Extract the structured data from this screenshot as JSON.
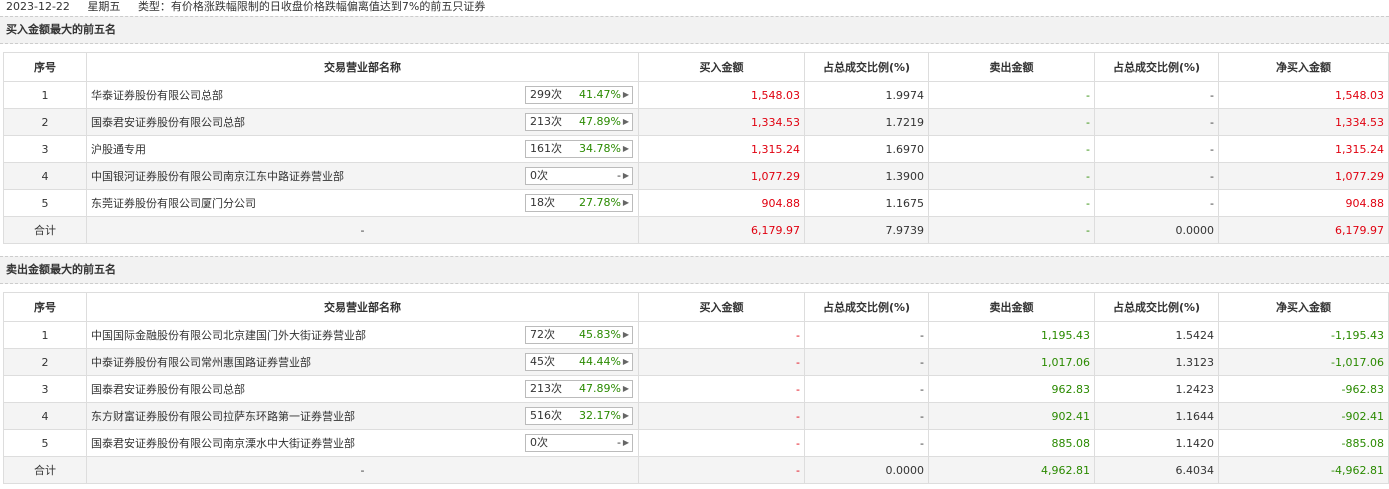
{
  "header": {
    "date": "2023-12-22",
    "weekday": "星期五",
    "type_label": "类型：有价格涨跌幅限制的日收盘价格跌幅偏离值达到7%的前五只证券"
  },
  "columns": [
    "序号",
    "交易营业部名称",
    "买入金额",
    "占总成交比例(%)",
    "卖出金额",
    "占总成交比例(%)",
    "净买入金额"
  ],
  "buy_section": {
    "title": "买入金额最大的前五名",
    "rows": [
      {
        "idx": "1",
        "name": "华泰证券股份有限公司总部",
        "count": "299次",
        "pct": "41.47%",
        "buy": "1,548.03",
        "buy_ratio": "1.9974",
        "sell": "-",
        "sell_ratio": "-",
        "net": "1,548.03"
      },
      {
        "idx": "2",
        "name": "国泰君安证券股份有限公司总部",
        "count": "213次",
        "pct": "47.89%",
        "buy": "1,334.53",
        "buy_ratio": "1.7219",
        "sell": "-",
        "sell_ratio": "-",
        "net": "1,334.53"
      },
      {
        "idx": "3",
        "name": "沪股通专用",
        "count": "161次",
        "pct": "34.78%",
        "buy": "1,315.24",
        "buy_ratio": "1.6970",
        "sell": "-",
        "sell_ratio": "-",
        "net": "1,315.24"
      },
      {
        "idx": "4",
        "name": "中国银河证券股份有限公司南京江东中路证券营业部",
        "count": "0次",
        "pct": "-",
        "buy": "1,077.29",
        "buy_ratio": "1.3900",
        "sell": "-",
        "sell_ratio": "-",
        "net": "1,077.29"
      },
      {
        "idx": "5",
        "name": "东莞证券股份有限公司厦门分公司",
        "count": "18次",
        "pct": "27.78%",
        "buy": "904.88",
        "buy_ratio": "1.1675",
        "sell": "-",
        "sell_ratio": "-",
        "net": "904.88"
      }
    ],
    "total": {
      "label": "合计",
      "name": "-",
      "buy": "6,179.97",
      "buy_ratio": "7.9739",
      "sell": "-",
      "sell_ratio": "0.0000",
      "net": "6,179.97"
    }
  },
  "sell_section": {
    "title": "卖出金额最大的前五名",
    "rows": [
      {
        "idx": "1",
        "name": "中国国际金融股份有限公司北京建国门外大街证券营业部",
        "count": "72次",
        "pct": "45.83%",
        "buy": "-",
        "buy_ratio": "-",
        "sell": "1,195.43",
        "sell_ratio": "1.5424",
        "net": "-1,195.43"
      },
      {
        "idx": "2",
        "name": "中泰证券股份有限公司常州惠国路证券营业部",
        "count": "45次",
        "pct": "44.44%",
        "buy": "-",
        "buy_ratio": "-",
        "sell": "1,017.06",
        "sell_ratio": "1.3123",
        "net": "-1,017.06"
      },
      {
        "idx": "3",
        "name": "国泰君安证券股份有限公司总部",
        "count": "213次",
        "pct": "47.89%",
        "buy": "-",
        "buy_ratio": "-",
        "sell": "962.83",
        "sell_ratio": "1.2423",
        "net": "-962.83"
      },
      {
        "idx": "4",
        "name": "东方财富证券股份有限公司拉萨东环路第一证券营业部",
        "count": "516次",
        "pct": "32.17%",
        "buy": "-",
        "buy_ratio": "-",
        "sell": "902.41",
        "sell_ratio": "1.1644",
        "net": "-902.41"
      },
      {
        "idx": "5",
        "name": "国泰君安证券股份有限公司南京溧水中大街证券营业部",
        "count": "0次",
        "pct": "-",
        "buy": "-",
        "buy_ratio": "-",
        "sell": "885.08",
        "sell_ratio": "1.1420",
        "net": "-885.08"
      }
    ],
    "total": {
      "label": "合计",
      "name": "-",
      "buy": "-",
      "buy_ratio": "0.0000",
      "sell": "4,962.81",
      "sell_ratio": "6.4034",
      "net": "-4,962.81"
    }
  },
  "colors": {
    "red": "#e0000f",
    "green": "#2a8a00"
  }
}
